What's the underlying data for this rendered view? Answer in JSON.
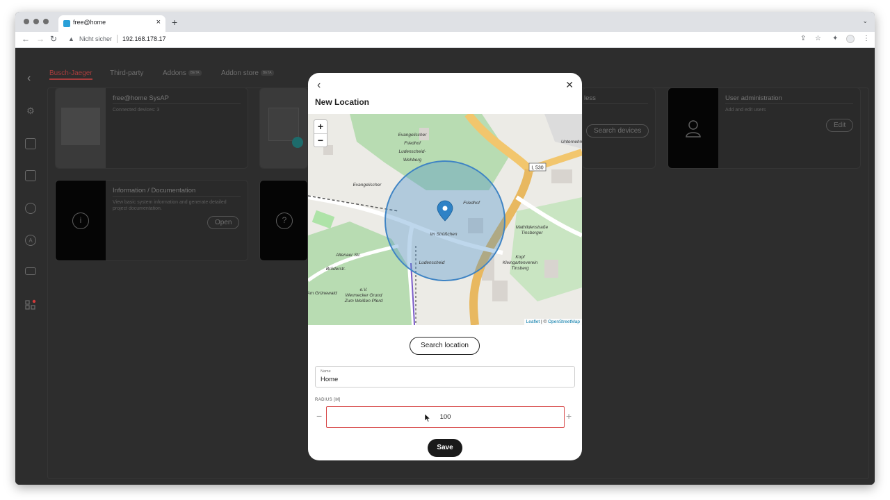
{
  "browser": {
    "tab_title": "free@home",
    "tab_close": "×",
    "new_tab": "+",
    "tab_dropdown": "⌄",
    "security_label": "Nicht sicher",
    "url": "192.168.178.17"
  },
  "app": {
    "tabs": [
      {
        "label": "Busch-Jaeger"
      },
      {
        "label": "Third-party"
      },
      {
        "label": "Addons",
        "badge": "BETA"
      },
      {
        "label": "Addon store",
        "badge": "BETA"
      }
    ],
    "cards": {
      "sysap": {
        "title": "free@home SysAP",
        "subtitle": "Connected devices: 3"
      },
      "wireless": {
        "title_fragment": "less",
        "button": "Search devices"
      },
      "user_admin": {
        "title": "User administration",
        "subtitle": "Add and edit users",
        "button": "Edit"
      },
      "info": {
        "title": "Information / Documentation",
        "subtitle": "View basic system information and generate detailed project documentation.",
        "button": "Open"
      }
    }
  },
  "modal": {
    "title": "New Location",
    "map": {
      "zoom_in": "+",
      "zoom_out": "−",
      "attribution_leaflet": "Leaflet",
      "attribution_sep": " | © ",
      "attribution_osm": "OpenStreetMap",
      "road_label": "L 530",
      "place_labels": [
        "Evangelischer",
        "Friedhof",
        "Ludenscheid-",
        "Wehberg",
        "Evangelischer",
        "Friedhof",
        "Ludenscheid",
        "Mathildenstraße",
        "Tinsberger",
        "Kopf",
        "Kleingartenverein",
        "Tinsberg",
        "e.V.",
        "Wermecker Grund",
        "Zum Weißen Pferd",
        "Altenaer Str.",
        "Brüderstr.",
        "Am Grünewald",
        "Im Strüßchen",
        "Unternehm"
      ]
    },
    "search_button": "Search location",
    "name_label": "Name",
    "name_value": "Home",
    "radius_label": "RADIUS [M]",
    "radius_value": "100",
    "minus": "−",
    "plus": "+",
    "save_button": "Save"
  }
}
